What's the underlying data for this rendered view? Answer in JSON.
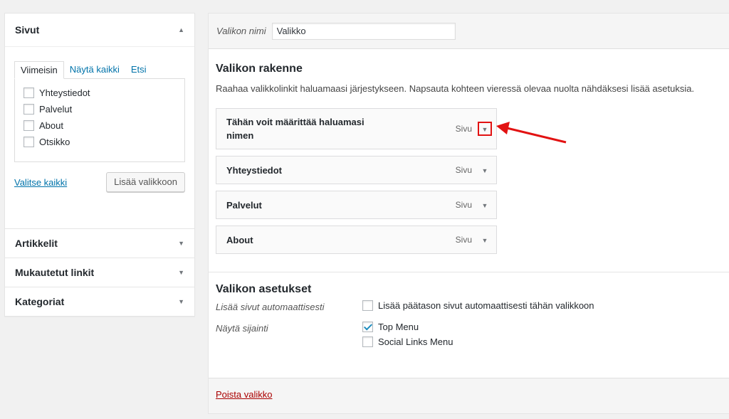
{
  "sidebar": {
    "pages": {
      "title": "Sivut",
      "tabs": [
        {
          "label": "Viimeisin"
        },
        {
          "label": "Näytä kaikki"
        },
        {
          "label": "Etsi"
        }
      ],
      "items": [
        {
          "label": "Yhteystiedot"
        },
        {
          "label": "Palvelut"
        },
        {
          "label": "About"
        },
        {
          "label": "Otsikko"
        }
      ],
      "select_all": "Valitse kaikki",
      "add_button": "Lisää valikkoon"
    },
    "sections": [
      {
        "title": "Artikkelit"
      },
      {
        "title": "Mukautetut linkit"
      },
      {
        "title": "Kategoriat"
      }
    ]
  },
  "menu": {
    "name_label": "Valikon nimi",
    "name_value": "Valikko",
    "structure_title": "Valikon rakenne",
    "structure_desc": "Raahaa valikkolinkit haluamaasi järjestykseen. Napsauta kohteen vieressä olevaa nuolta nähdäksesi lisää asetuksia.",
    "items": [
      {
        "title_line1": "Tähän voit määrittää haluamasi",
        "title_line2": "nimen",
        "type": "Sivu",
        "highlighted": true
      },
      {
        "title": "Yhteystiedot",
        "type": "Sivu"
      },
      {
        "title": "Palvelut",
        "type": "Sivu"
      },
      {
        "title": "About",
        "type": "Sivu"
      }
    ],
    "settings_title": "Valikon asetukset",
    "auto_add_label": "Lisää sivut automaattisesti",
    "auto_add_option": "Lisää päätason sivut automaattisesti tähän valikkoon",
    "location_label": "Näytä sijainti",
    "locations": [
      {
        "label": "Top Menu",
        "checked": true
      },
      {
        "label": "Social Links Menu",
        "checked": false
      }
    ],
    "delete_link": "Poista valikko"
  },
  "icons": {
    "collapse": "triangle-up-icon",
    "expand": "triangle-down-icon"
  },
  "colors": {
    "link": "#0073aa",
    "delete": "#a00000",
    "annotation": "#e21212",
    "checkmark": "#1e8cbe"
  }
}
